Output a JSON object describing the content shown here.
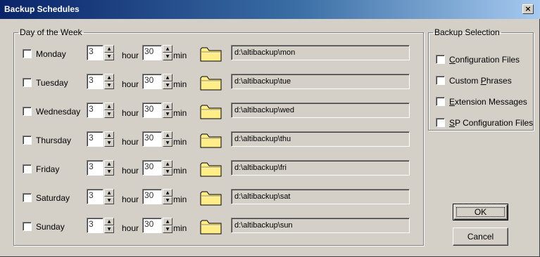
{
  "window": {
    "title": "Backup Schedules",
    "close_glyph": "×"
  },
  "day_group": {
    "legend": "Day of the Week"
  },
  "units": {
    "hour": "hour",
    "min": "min"
  },
  "days": [
    {
      "label": "Monday",
      "checked": false,
      "hour": "3",
      "min": "30",
      "path": "d:\\altibackup\\mon"
    },
    {
      "label": "Tuesday",
      "checked": false,
      "hour": "3",
      "min": "30",
      "path": "d:\\altibackup\\tue"
    },
    {
      "label": "Wednesday",
      "checked": false,
      "hour": "3",
      "min": "30",
      "path": "d:\\altibackup\\wed"
    },
    {
      "label": "Thursday",
      "checked": false,
      "hour": "3",
      "min": "30",
      "path": "d:\\altibackup\\thu"
    },
    {
      "label": "Friday",
      "checked": false,
      "hour": "3",
      "min": "30",
      "path": "d:\\altibackup\\fri"
    },
    {
      "label": "Saturday",
      "checked": false,
      "hour": "3",
      "min": "30",
      "path": "d:\\altibackup\\sat"
    },
    {
      "label": "Sunday",
      "checked": false,
      "hour": "3",
      "min": "30",
      "path": "d:\\altibackup\\sun"
    }
  ],
  "selection_group": {
    "legend": "Backup Selection",
    "items": [
      {
        "label": "Configuration Files",
        "checked": false,
        "mnemonic": "C"
      },
      {
        "label": "Custom Phrases",
        "checked": false,
        "mnemonic": "P"
      },
      {
        "label": "Extension Messages",
        "checked": false,
        "mnemonic": "E"
      },
      {
        "label": "SP Configuration Files",
        "checked": false,
        "mnemonic": "S"
      }
    ]
  },
  "buttons": {
    "ok": "OK",
    "cancel": "Cancel"
  },
  "icons": {
    "folder": "folder-icon",
    "spin_up": "up-arrow-icon",
    "spin_down": "down-arrow-icon"
  },
  "colors": {
    "title_start": "#0a246a",
    "title_end": "#a6caf0",
    "face": "#d4d0c8",
    "folder": "#ffee88"
  }
}
